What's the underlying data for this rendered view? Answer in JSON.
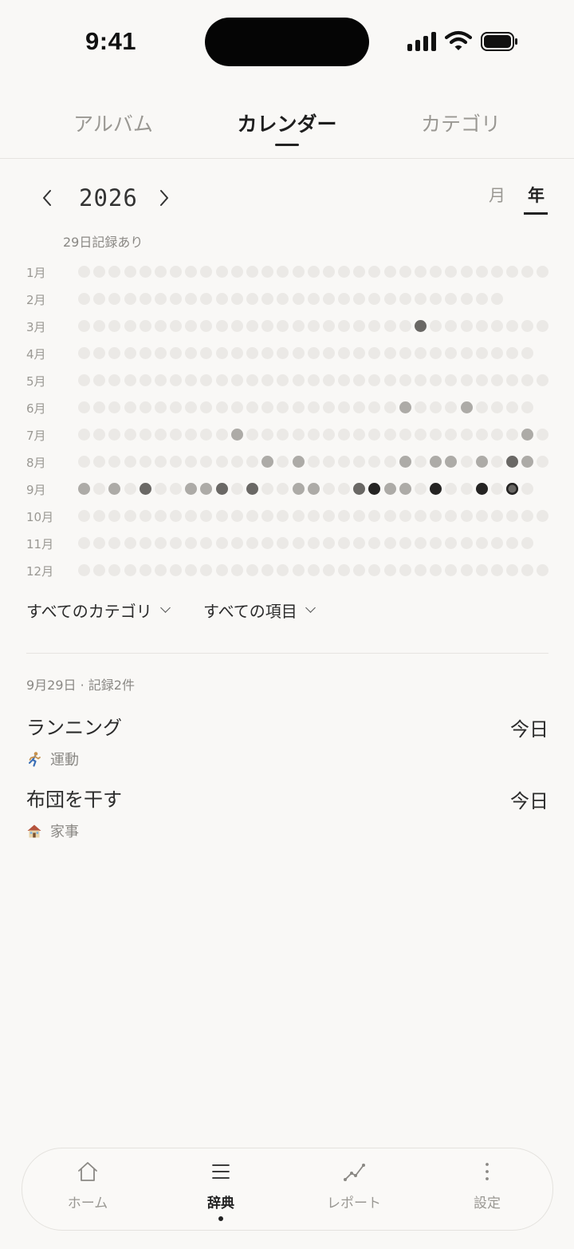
{
  "status_bar": {
    "time": "9:41"
  },
  "top_tabs": [
    {
      "label": "アルバム",
      "active": false
    },
    {
      "label": "カレンダー",
      "active": true
    },
    {
      "label": "カテゴリ",
      "active": false
    }
  ],
  "year_nav": {
    "year": "2026",
    "prev_icon": "chevron-left-icon",
    "next_icon": "chevron-right-icon"
  },
  "view_modes": [
    {
      "label": "月",
      "active": false
    },
    {
      "label": "年",
      "active": true
    }
  ],
  "record_count": "29日記録あり",
  "heatmap": {
    "months": [
      {
        "label": "1月",
        "days": 31,
        "marks": {}
      },
      {
        "label": "2月",
        "days": 28,
        "marks": {}
      },
      {
        "label": "3月",
        "days": 31,
        "marks": {
          "23": 2
        }
      },
      {
        "label": "4月",
        "days": 30,
        "marks": {}
      },
      {
        "label": "5月",
        "days": 31,
        "marks": {}
      },
      {
        "label": "6月",
        "days": 30,
        "marks": {
          "22": 1,
          "26": 1
        }
      },
      {
        "label": "7月",
        "days": 31,
        "marks": {
          "11": 1,
          "30": 1
        }
      },
      {
        "label": "8月",
        "days": 31,
        "marks": {
          "13": 1,
          "15": 1,
          "22": 1,
          "24": 1,
          "25": 1,
          "27": 1,
          "29": 2,
          "30": 1
        }
      },
      {
        "label": "9月",
        "days": 30,
        "marks": {
          "1": 1,
          "3": 1,
          "5": 2,
          "8": 1,
          "9": 1,
          "10": 2,
          "12": 2,
          "15": 1,
          "16": 1,
          "19": 2,
          "20": 3,
          "21": 1,
          "22": 1,
          "24": 3,
          "27": 3,
          "29": 4
        }
      },
      {
        "label": "10月",
        "days": 31,
        "marks": {}
      },
      {
        "label": "11月",
        "days": 30,
        "marks": {}
      },
      {
        "label": "12月",
        "days": 31,
        "marks": {}
      }
    ],
    "level_colors": [
      "#ebe9e6",
      "#adaba7",
      "#6a6865",
      "#252423",
      "#6a6865"
    ],
    "selected_ring_color": "#252423"
  },
  "filters": {
    "category": "すべてのカテゴリ",
    "item": "すべての項目"
  },
  "selected_day": {
    "header": "9月29日 · 記録2件",
    "entries": [
      {
        "title": "ランニング",
        "when": "今日",
        "category_icon": "runner-icon",
        "category": "運動"
      },
      {
        "title": "布団を干す",
        "when": "今日",
        "category_icon": "house-icon",
        "category": "家事"
      }
    ]
  },
  "bottom_nav": [
    {
      "label": "ホーム",
      "icon": "home-icon",
      "active": false
    },
    {
      "label": "辞典",
      "icon": "list-icon",
      "active": true
    },
    {
      "label": "レポート",
      "icon": "chart-icon",
      "active": false
    },
    {
      "label": "設定",
      "icon": "more-vertical-icon",
      "active": false
    }
  ]
}
